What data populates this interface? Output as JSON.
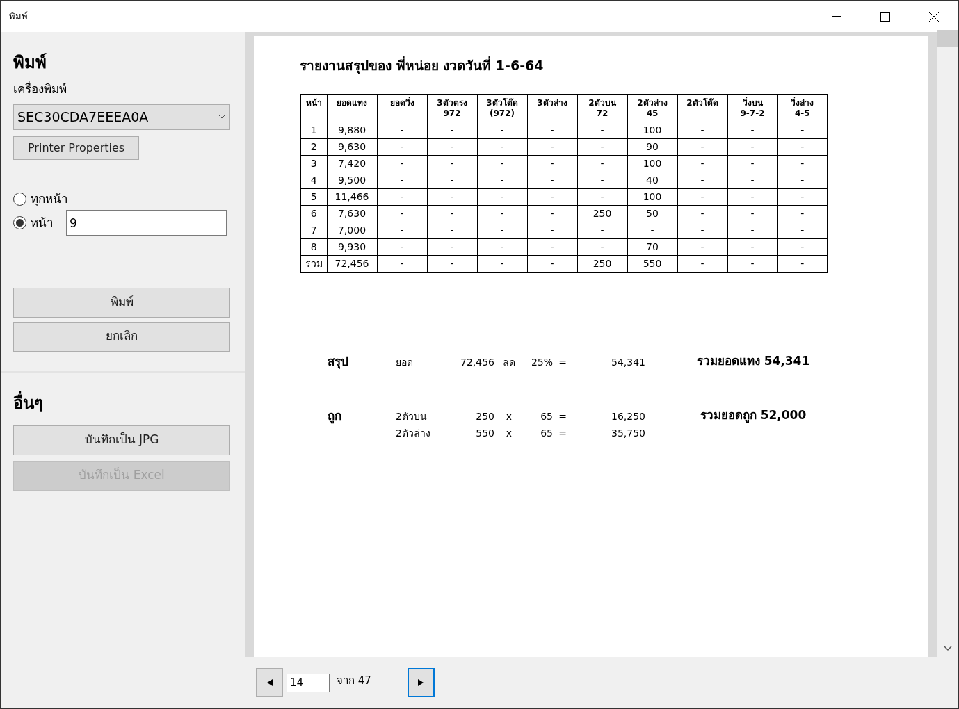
{
  "window": {
    "title": "พิมพ์"
  },
  "sidebar": {
    "heading": "พิมพ์",
    "printer_label": "เครื่องพิมพ์",
    "printer": "SEC30CDA7EEEA0A",
    "properties_button": "Printer Properties",
    "range_options": [
      {
        "label": "ทุกหน้า",
        "selected": false,
        "kind": "plain"
      },
      {
        "label": "หน้า",
        "selected": true,
        "kind": "pages",
        "value": "9"
      }
    ],
    "buttons": [
      {
        "label": "พิมพ์",
        "disabled": false
      },
      {
        "label": "ยกเลิก",
        "disabled": false
      }
    ],
    "other_heading": "อื่นๆ",
    "other_buttons": [
      {
        "label": "บันทึกเป็น JPG",
        "disabled": false
      },
      {
        "label": "บันทึกเป็น Excel",
        "disabled": true
      }
    ]
  },
  "preview": {
    "title": "รายงานสรุปของ พี่หน่อย งวดวันที่ 1-6-64",
    "table": {
      "columns": [
        "หน้า",
        "ยอดแทง",
        "ยอดวิ่ง",
        "3ตัวตรง 972",
        "3ตัวโต๊ด (972)",
        "3ตัวล่าง",
        "2ตัวบน 72",
        "2ตัวล่าง 45",
        "2ตัวโต๊ด",
        "วิ่งบน 9-7-2",
        "วิ่งล่าง 4-5"
      ],
      "rows": [
        [
          "1",
          "9,880",
          "-",
          "-",
          "-",
          "-",
          "-",
          "100",
          "-",
          "-",
          "-"
        ],
        [
          "2",
          "9,630",
          "-",
          "-",
          "-",
          "-",
          "-",
          "90",
          "-",
          "-",
          "-"
        ],
        [
          "3",
          "7,420",
          "-",
          "-",
          "-",
          "-",
          "-",
          "100",
          "-",
          "-",
          "-"
        ],
        [
          "4",
          "9,500",
          "-",
          "-",
          "-",
          "-",
          "-",
          "40",
          "-",
          "-",
          "-"
        ],
        [
          "5",
          "11,466",
          "-",
          "-",
          "-",
          "-",
          "-",
          "100",
          "-",
          "-",
          "-"
        ],
        [
          "6",
          "7,630",
          "-",
          "-",
          "-",
          "-",
          "250",
          "50",
          "-",
          "-",
          "-"
        ],
        [
          "7",
          "7,000",
          "-",
          "-",
          "-",
          "-",
          "-",
          "-",
          "-",
          "-",
          "-"
        ],
        [
          "8",
          "9,930",
          "-",
          "-",
          "-",
          "-",
          "-",
          "70",
          "-",
          "-",
          "-"
        ],
        [
          "รวม",
          "72,456",
          "-",
          "-",
          "-",
          "-",
          "250",
          "550",
          "-",
          "-",
          "-"
        ]
      ]
    },
    "summary": [
      {
        "label": "สรุป",
        "lines": [
          [
            "ยอด",
            "72,456",
            "ลด",
            "25%",
            "=",
            "54,341"
          ]
        ],
        "total": "รวมยอดแทง 54,341"
      },
      {
        "label": "ถูก",
        "lines": [
          [
            "2ตัวบน",
            "250",
            "x",
            "65",
            "=",
            "16,250"
          ],
          [
            "2ตัวล่าง",
            "550",
            "x",
            "65",
            "=",
            "35,750"
          ]
        ],
        "total": "รวมยอดถูก 52,000"
      }
    ]
  },
  "pager": {
    "page": "14",
    "of": "จาก 47"
  }
}
